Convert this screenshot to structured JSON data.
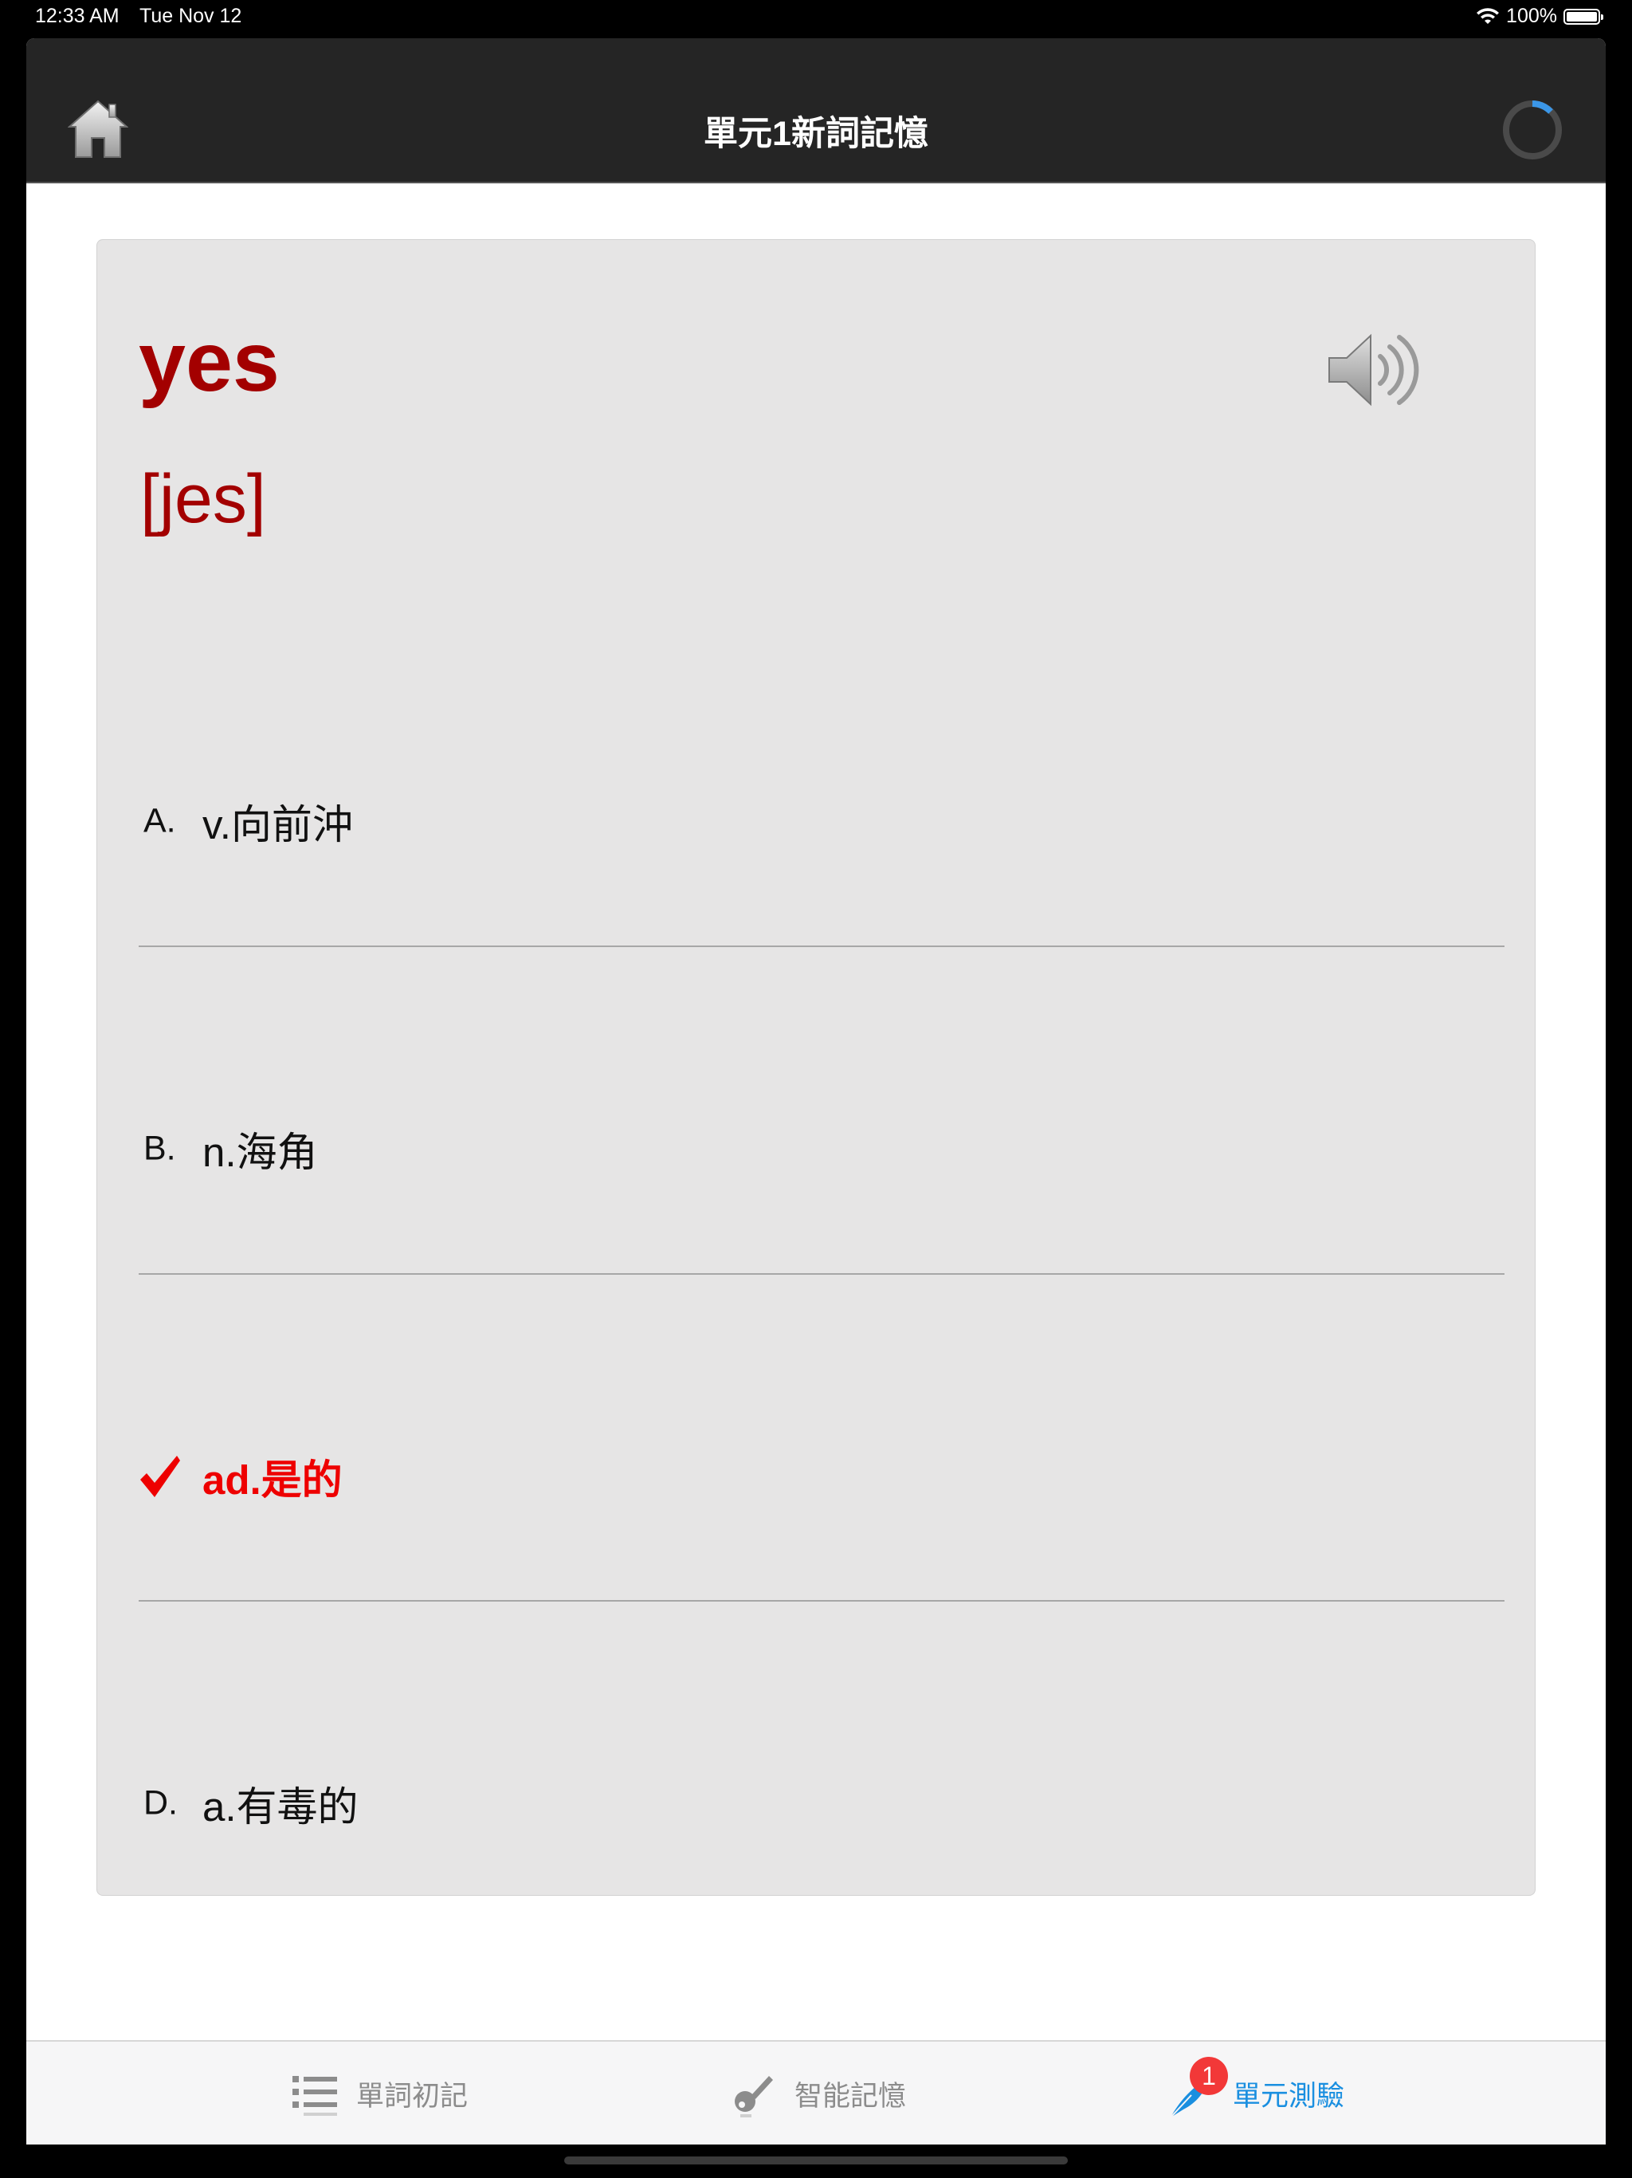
{
  "status_bar": {
    "time": "12:33 AM",
    "date": "Tue Nov 12",
    "battery": "100%"
  },
  "nav": {
    "title": "單元1新詞記憶"
  },
  "card": {
    "word": "yes",
    "phonetic": "[jes]",
    "options": [
      {
        "letter": "A.",
        "text": "v.向前沖"
      },
      {
        "letter": "B.",
        "text": "n.海角"
      },
      {
        "letter": "",
        "text": "ad.是的"
      },
      {
        "letter": "D.",
        "text": "a.有毒的"
      }
    ]
  },
  "tabs": [
    {
      "label": "單詞初記"
    },
    {
      "label": "智能記憶"
    },
    {
      "label": "單元測驗",
      "badge": "1"
    }
  ],
  "colors": {
    "word_red": "#a30000",
    "correct_red": "#ee0000",
    "nav_bg": "#252525",
    "card_bg": "#e6e5e5",
    "tab_active": "#1a8fe0",
    "tab_inactive": "#8c8c8c",
    "badge": "#f23838"
  },
  "icons": [
    "home-icon",
    "loading-spinner-icon",
    "speaker-icon",
    "checkmark-icon",
    "list-icon",
    "key-icon",
    "quill-icon",
    "wifi-icon",
    "battery-icon"
  ]
}
